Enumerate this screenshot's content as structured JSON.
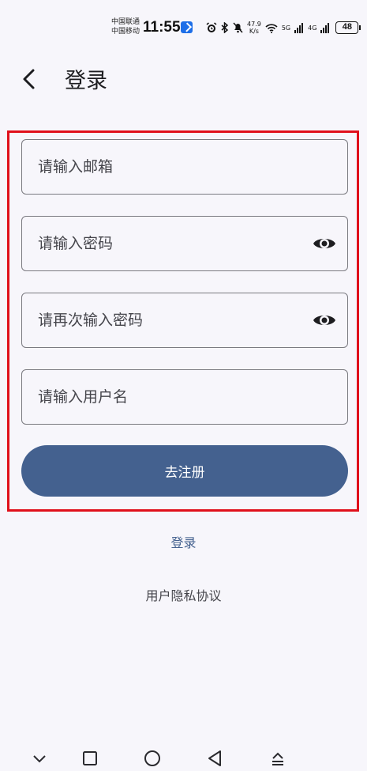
{
  "status_bar": {
    "carrier_1": "中国联通",
    "carrier_2": "中国移动",
    "time": "11:55",
    "net_speed_value": "47.9",
    "net_speed_unit": "K/s",
    "signal_1": "5G",
    "signal_2": "4G",
    "battery": "48"
  },
  "header": {
    "title": "登录",
    "back_icon": "chevron-left-icon"
  },
  "form": {
    "email_placeholder": "请输入邮箱",
    "password_placeholder": "请输入密码",
    "confirm_password_placeholder": "请再次输入密码",
    "username_placeholder": "请输入用户名",
    "visibility_icon": "eye-icon",
    "submit_label": "去注册"
  },
  "links": {
    "login": "登录",
    "privacy": "用户隐私协议"
  },
  "colors": {
    "primary": "#44618f",
    "background": "#f7f6fb",
    "highlight_border": "#e0101b"
  },
  "nav": {
    "icons": [
      "chevron-down-icon",
      "square-icon",
      "circle-icon",
      "triangle-left-icon",
      "upload-icon"
    ]
  }
}
